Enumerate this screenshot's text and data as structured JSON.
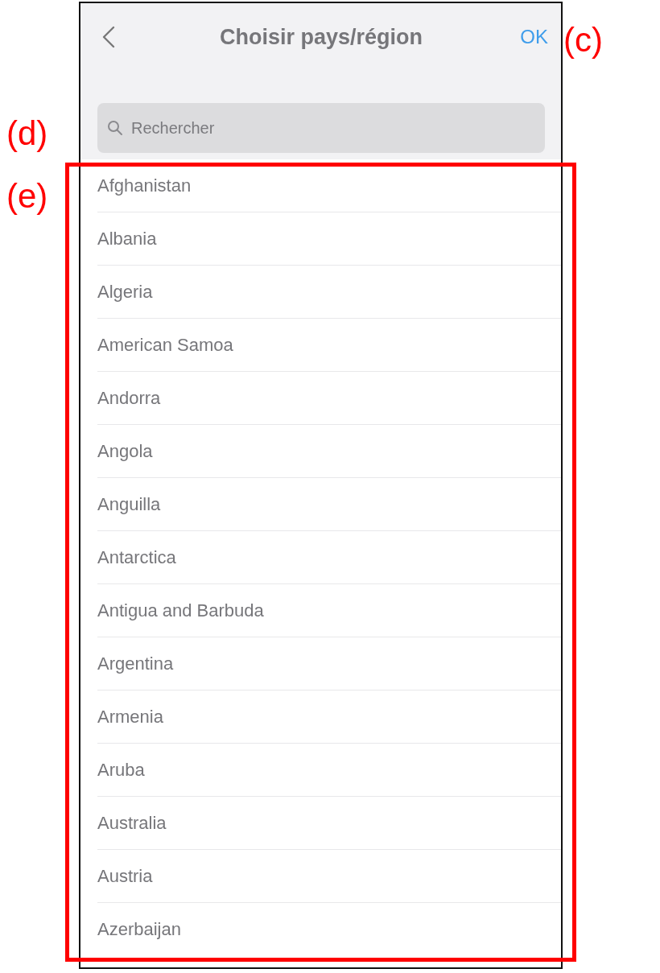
{
  "screen": {
    "title": "Choisir pays/région",
    "ok": "OK",
    "search": {
      "placeholder": "Rechercher"
    },
    "countries": [
      "Afghanistan",
      "Albania",
      "Algeria",
      "American Samoa",
      "Andorra",
      "Angola",
      "Anguilla",
      "Antarctica",
      "Antigua and Barbuda",
      "Argentina",
      "Armenia",
      "Aruba",
      "Australia",
      "Austria",
      "Azerbaijan"
    ]
  },
  "annotations": [
    {
      "label": "(c)"
    },
    {
      "label": "(d)"
    },
    {
      "label": "(e)"
    }
  ]
}
